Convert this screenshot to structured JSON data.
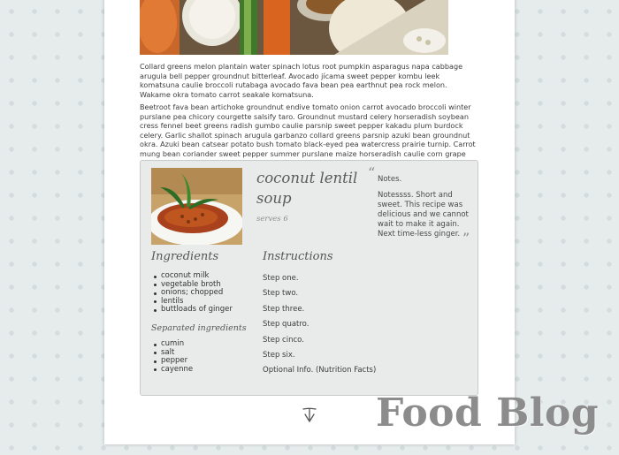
{
  "article": {
    "paragraph_1": "Collard greens melon plantain water spinach lotus root pumpkin asparagus napa cabbage arugula bell pepper groundnut bitterleaf. Avocado jícama sweet pepper kombu leek komatsuna caulie broccoli rutabaga avocado fava bean pea earthnut pea rock melon. Wakame okra tomato carrot seakale komatsuna.",
    "paragraph_2": "Beetroot fava bean artichoke groundnut endive tomato onion carrot avocado broccoli winter purslane pea chicory courgette salsify taro. Groundnut mustard celery horseradish soybean cress fennel beet greens radish gumbo caulie parsnip sweet pepper kakadu plum burdock celery. Garlic shallot spinach arugula garbanzo collard greens parsnip azuki bean groundnut okra. Azuki bean catsear potato bush tomato black-eyed pea watercress prairie turnip. Carrot mung bean coriander sweet pepper summer purslane maize horseradish caulie corn grape collard greens."
  },
  "recipe": {
    "title": "coconut lentil soup",
    "serves": "serves 6",
    "notes_label": "Notes.",
    "notes_text": "Notessss. Short and sweet. This recipe was delicious and we cannot wait to make it again. Next time-less ginger.",
    "quote_open": "“",
    "quote_close": "”",
    "ingredients_heading": "Ingredients",
    "ingredients": [
      "coconut milk",
      "vegetable broth",
      "onions; chopped",
      "lentils",
      "buttloads of ginger"
    ],
    "separated_heading": "Separated ingredients",
    "separated_ingredients": [
      "cumin",
      "salt",
      "pepper",
      "cayenne"
    ],
    "instructions_heading": "Instructions",
    "steps": [
      "Step one.",
      "Step two.",
      "Step three.",
      "Step quatro.",
      "Step cinco.",
      "Step six.",
      "Optional Info. (Nutrition Facts)"
    ]
  },
  "footer": {
    "signature_icon": "signature-logo-icon"
  },
  "brand": {
    "watermark": "Food Blog"
  },
  "colors": {
    "card_bg": "#e9eaea",
    "page_bg": "#e6ecec",
    "watermark": "#8c8c8c"
  }
}
